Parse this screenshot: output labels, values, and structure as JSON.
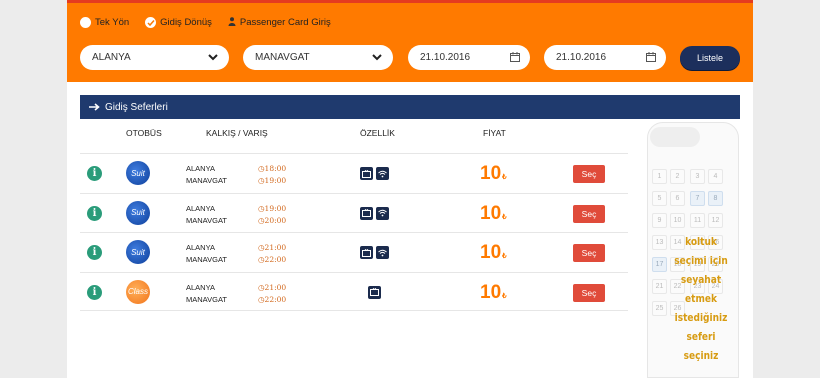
{
  "trip_type": {
    "one_way": "Tek Yön",
    "round_trip": "Gidiş Dönüş",
    "passenger_card": "Passenger Card Giriş"
  },
  "search": {
    "from": "ALANYA",
    "to": "MANAVGAT",
    "depart_date": "21.10.2016",
    "return_date": "21.10.2016",
    "list_button": "Listele"
  },
  "results": {
    "title": "Gidiş Seferleri",
    "columns": {
      "bus": "OTOBÜS",
      "route": "KALKIŞ / VARIŞ",
      "features": "ÖZELLİK",
      "price": "FİYAT"
    },
    "rows": [
      {
        "brand": "Suit",
        "from": "ALANYA",
        "to": "MANAVGAT",
        "dep": "18:00",
        "arr": "19:00",
        "features": [
          "tv-icon",
          "wifi-icon"
        ],
        "price": "10",
        "currency": "₺",
        "select": "Seç"
      },
      {
        "brand": "Suit",
        "from": "ALANYA",
        "to": "MANAVGAT",
        "dep": "19:00",
        "arr": "20:00",
        "features": [
          "tv-icon",
          "wifi-icon"
        ],
        "price": "10",
        "currency": "₺",
        "select": "Seç"
      },
      {
        "brand": "Suit",
        "from": "ALANYA",
        "to": "MANAVGAT",
        "dep": "21:00",
        "arr": "22:00",
        "features": [
          "tv-icon",
          "wifi-icon"
        ],
        "price": "10",
        "currency": "₺",
        "select": "Seç"
      },
      {
        "brand": "Class",
        "from": "ALANYA",
        "to": "MANAVGAT",
        "dep": "21:00",
        "arr": "22:00",
        "features": [
          "tv-icon"
        ],
        "price": "10",
        "currency": "₺",
        "select": "Seç"
      }
    ]
  },
  "seat_map": {
    "message": [
      "koltuk",
      "seçimi için",
      "seyahat etmek",
      "istediğiniz",
      "seferi seçiniz"
    ],
    "seats": [
      "1",
      "2",
      "3",
      "4",
      "5",
      "6",
      "7",
      "8",
      "9",
      "10",
      "11",
      "12",
      "13",
      "14",
      "15",
      "16",
      "17",
      "18",
      "19",
      "20",
      "21",
      "22",
      "23",
      "24",
      "25",
      "26"
    ]
  },
  "colors": {
    "header_orange": "#ff7a00",
    "top_strip": "#e53b1f",
    "navy": "#1f3a6e",
    "select_red": "#e04b3a",
    "price_orange": "#ff7a00",
    "info_green": "#2a9c7a"
  }
}
